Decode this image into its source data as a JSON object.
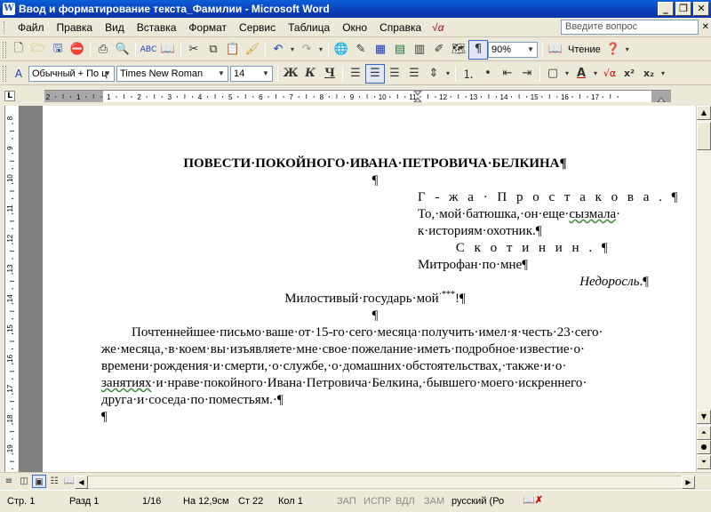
{
  "window": {
    "title": "Ввод и форматирование текста_Фамилии - Microsoft Word",
    "minimize": "_",
    "maximize": "❐",
    "close": "✕"
  },
  "menu": {
    "items": [
      "Файл",
      "Правка",
      "Вид",
      "Вставка",
      "Формат",
      "Сервис",
      "Таблица",
      "Окно",
      "Справка"
    ],
    "special": "√α",
    "help_placeholder": "Введите вопрос",
    "doc_close": "✕"
  },
  "standard_toolbar": {
    "zoom": "90%",
    "reading_label": "Чтение"
  },
  "formatting_toolbar": {
    "style": "Обычный + По ц",
    "font": "Times New Roman",
    "size": "14",
    "bold": "Ж",
    "italic": "К",
    "underline": "Ч"
  },
  "ruler": {
    "horizontal_ticks": [
      "2",
      "1",
      "1",
      "2",
      "3",
      "4",
      "5",
      "6",
      "7",
      "8",
      "9",
      "10",
      "11",
      "12",
      "13",
      "14",
      "15",
      "16",
      "17"
    ],
    "vertical_ticks": [
      "8",
      "9",
      "10",
      "11",
      "12",
      "13",
      "14",
      "15",
      "16",
      "17",
      "18",
      "19"
    ],
    "corner": "L"
  },
  "document": {
    "title": "ПОВЕСТИ·ПОКОЙНОГО·ИВАНА·ПЕТРОВИЧА·БЕЛКИНА¶",
    "blank1": "¶",
    "epi_line1": "Г - ж а · П р о с т а к о в а . ¶",
    "epi_line2_a": "То,·мой·батюшка,·он·еще·",
    "epi_line2_b": "сызмала",
    "epi_line2_c": "·",
    "epi_line3": "к·историям·охотник.¶",
    "epi_line4": "С к о т и н и н . ¶",
    "epi_line5": "Митрофан·по·мне¶",
    "epi_source": "Недоросль",
    "epi_source_tail": ".¶",
    "salutation": "Милостивый·государь·мой",
    "salutation_sup": "·***",
    "salutation_tail": "!¶",
    "blank2": "¶",
    "body_line1": "Почтеннейшее·письмо·ваше·от·15-го·сего·месяца·получить·имел·я·честь·23·сего·",
    "body_line2": "же·месяца,·в·коем·вы·изъявляете·мне·свое·пожелание·иметь·подробное·известие·о·",
    "body_line3": "времени·рождения·и·смерти,·о·службе,·о·домашних·обстоятельствах,·также·и·о·",
    "body_line4_a": "занятиях",
    "body_line4_b": "·и·нраве·покойного·Ивана·Петровича·Белкина,·бывшего·моего·искреннего·",
    "body_line5": "друга·и·соседа·по·поместьям.·¶",
    "blank3": "¶"
  },
  "statusbar": {
    "page": "Стр. 1",
    "section": "Разд 1",
    "pages": "1/16",
    "at": "На 12,9см",
    "line": "Ст 22",
    "col": "Кол 1",
    "rec": "ЗАП",
    "trk": "ИСПР",
    "ext": "ВДЛ",
    "ovr": "ЗАМ",
    "language": "русский (Ро"
  }
}
